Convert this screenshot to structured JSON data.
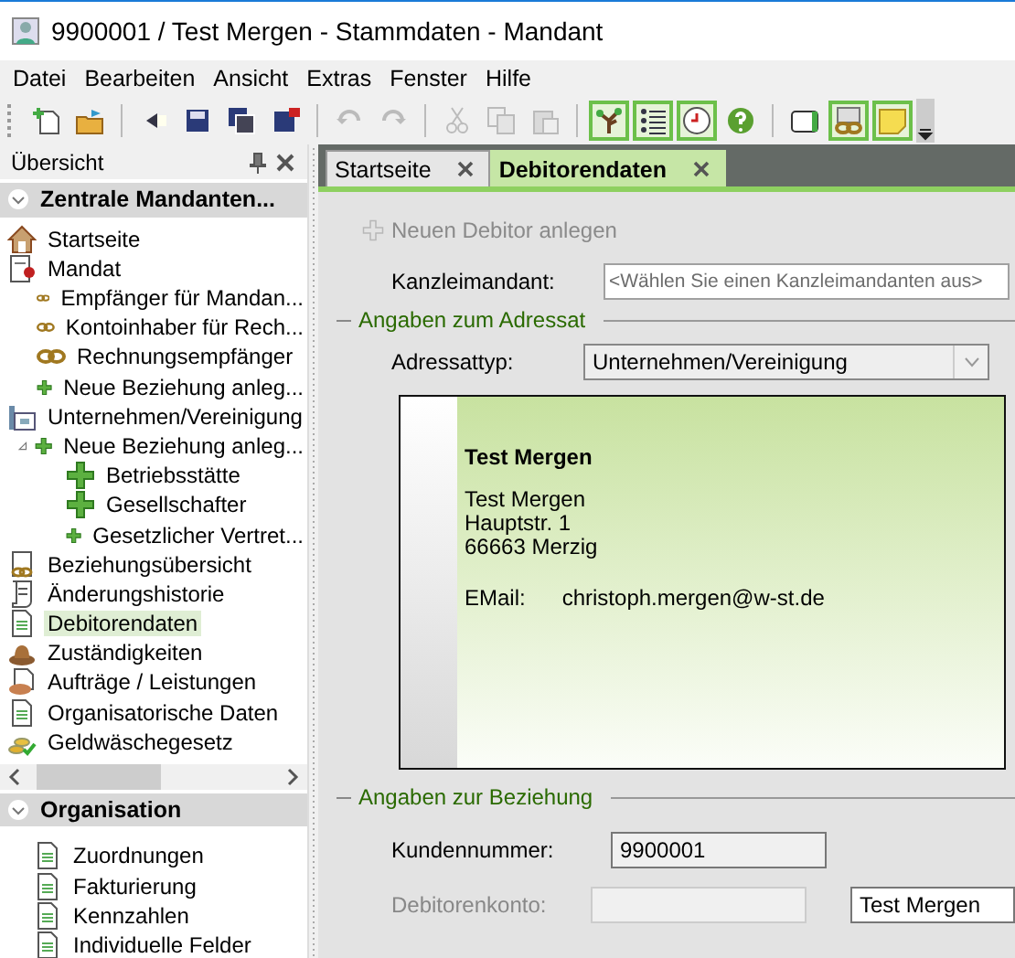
{
  "window": {
    "title": "9900001 / Test Mergen - Stammdaten - Mandant"
  },
  "menu": [
    "Datei",
    "Bearbeiten",
    "Ansicht",
    "Extras",
    "Fenster",
    "Hilfe"
  ],
  "toolbar": [
    {
      "kind": "new",
      "disabled": false
    },
    {
      "kind": "open",
      "disabled": false
    },
    {
      "kind": "sep"
    },
    {
      "kind": "back",
      "disabled": false
    },
    {
      "kind": "save",
      "disabled": false
    },
    {
      "kind": "saveall",
      "disabled": false
    },
    {
      "kind": "saveclose",
      "disabled": false
    },
    {
      "kind": "sep"
    },
    {
      "kind": "undo",
      "disabled": true
    },
    {
      "kind": "redo",
      "disabled": true
    },
    {
      "kind": "sep"
    },
    {
      "kind": "cut",
      "disabled": true
    },
    {
      "kind": "copy",
      "disabled": true
    },
    {
      "kind": "paste",
      "disabled": true
    },
    {
      "kind": "sep"
    },
    {
      "kind": "tree",
      "disabled": false,
      "checked": true
    },
    {
      "kind": "list",
      "disabled": false,
      "checked": true
    },
    {
      "kind": "history",
      "disabled": false,
      "checked": true
    },
    {
      "kind": "help",
      "disabled": false
    },
    {
      "kind": "sep"
    },
    {
      "kind": "lex",
      "disabled": false
    },
    {
      "kind": "links",
      "disabled": false,
      "checked": true
    },
    {
      "kind": "note",
      "disabled": false,
      "checked": true
    }
  ],
  "sidebar": {
    "title": "Übersicht",
    "sections": [
      {
        "title": "Zentrale Mandanten...",
        "expanded": true,
        "items": [
          {
            "label": "Startseite",
            "kind": "home",
            "selected": false
          },
          {
            "label": "Mandat",
            "kind": "mandate",
            "selected": false,
            "children": [
              {
                "label": "Empfänger für Mandan...",
                "kind": "link",
                "selected": false
              },
              {
                "label": "Kontoinhaber für Rech...",
                "kind": "link",
                "selected": false
              },
              {
                "label": "Rechnungsempfänger",
                "kind": "link",
                "selected": false
              },
              {
                "label": "Neue Beziehung anleg...",
                "kind": "plus",
                "selected": false
              }
            ]
          },
          {
            "label": "Unternehmen/Vereinigung",
            "kind": "company",
            "selected": false,
            "children": [
              {
                "label": "Neue Beziehung anleg...",
                "kind": "plus",
                "selected": false,
                "expanded": true,
                "children": [
                  {
                    "label": "Betriebsstätte",
                    "kind": "plus",
                    "selected": false
                  },
                  {
                    "label": "Gesellschafter",
                    "kind": "plus",
                    "selected": false
                  },
                  {
                    "label": "Gesetzlicher Vertret...",
                    "kind": "plus",
                    "selected": false
                  }
                ]
              }
            ]
          },
          {
            "label": "Beziehungsübersicht",
            "kind": "linkdoc",
            "selected": false
          },
          {
            "label": "Änderungshistorie",
            "kind": "scroll",
            "selected": false
          },
          {
            "label": "Debitorendaten",
            "kind": "doc",
            "selected": true
          },
          {
            "label": "Zuständigkeiten",
            "kind": "hat",
            "selected": false
          },
          {
            "label": "Aufträge / Leistungen",
            "kind": "orders",
            "selected": false
          },
          {
            "label": "Organisatorische Daten",
            "kind": "doc",
            "selected": false
          },
          {
            "label": "Geldwäschegesetz",
            "kind": "coins",
            "selected": false
          }
        ]
      },
      {
        "title": "Organisation",
        "expanded": true,
        "items": [
          {
            "label": "Zuordnungen",
            "kind": "doc",
            "selected": false
          },
          {
            "label": "Fakturierung",
            "kind": "doc",
            "selected": false
          },
          {
            "label": "Kennzahlen",
            "kind": "doc",
            "selected": false
          },
          {
            "label": "Individuelle Felder",
            "kind": "doc",
            "selected": false
          }
        ]
      }
    ]
  },
  "tabs": [
    {
      "label": "Startseite",
      "selected": false
    },
    {
      "label": "Debitorendaten",
      "selected": true
    }
  ],
  "form": {
    "new_button": {
      "label": "Neuen Debitor anlegen",
      "disabled": true
    },
    "kanzlei": {
      "label": "Kanzleimandant:",
      "placeholder": "<Wählen Sie einen Kanzleimandanten aus>"
    },
    "group_address": "Angaben zum Adressat",
    "address_type": {
      "label": "Adressattyp:",
      "value": "Unternehmen/Vereinigung"
    },
    "card": {
      "title": "Test Mergen",
      "lines": [
        "Test Mergen",
        "Hauptstr. 1",
        "66663 Merzig"
      ],
      "email_label": "EMail:",
      "email": "christoph.mergen@w-st.de"
    },
    "group_relation": "Angaben zur Beziehung",
    "customer_number": {
      "label": "Kundennummer:",
      "value": "9900001"
    },
    "debtor_account": {
      "label": "Debitorenkonto:",
      "disabled": true,
      "name": "Test Mergen"
    }
  }
}
